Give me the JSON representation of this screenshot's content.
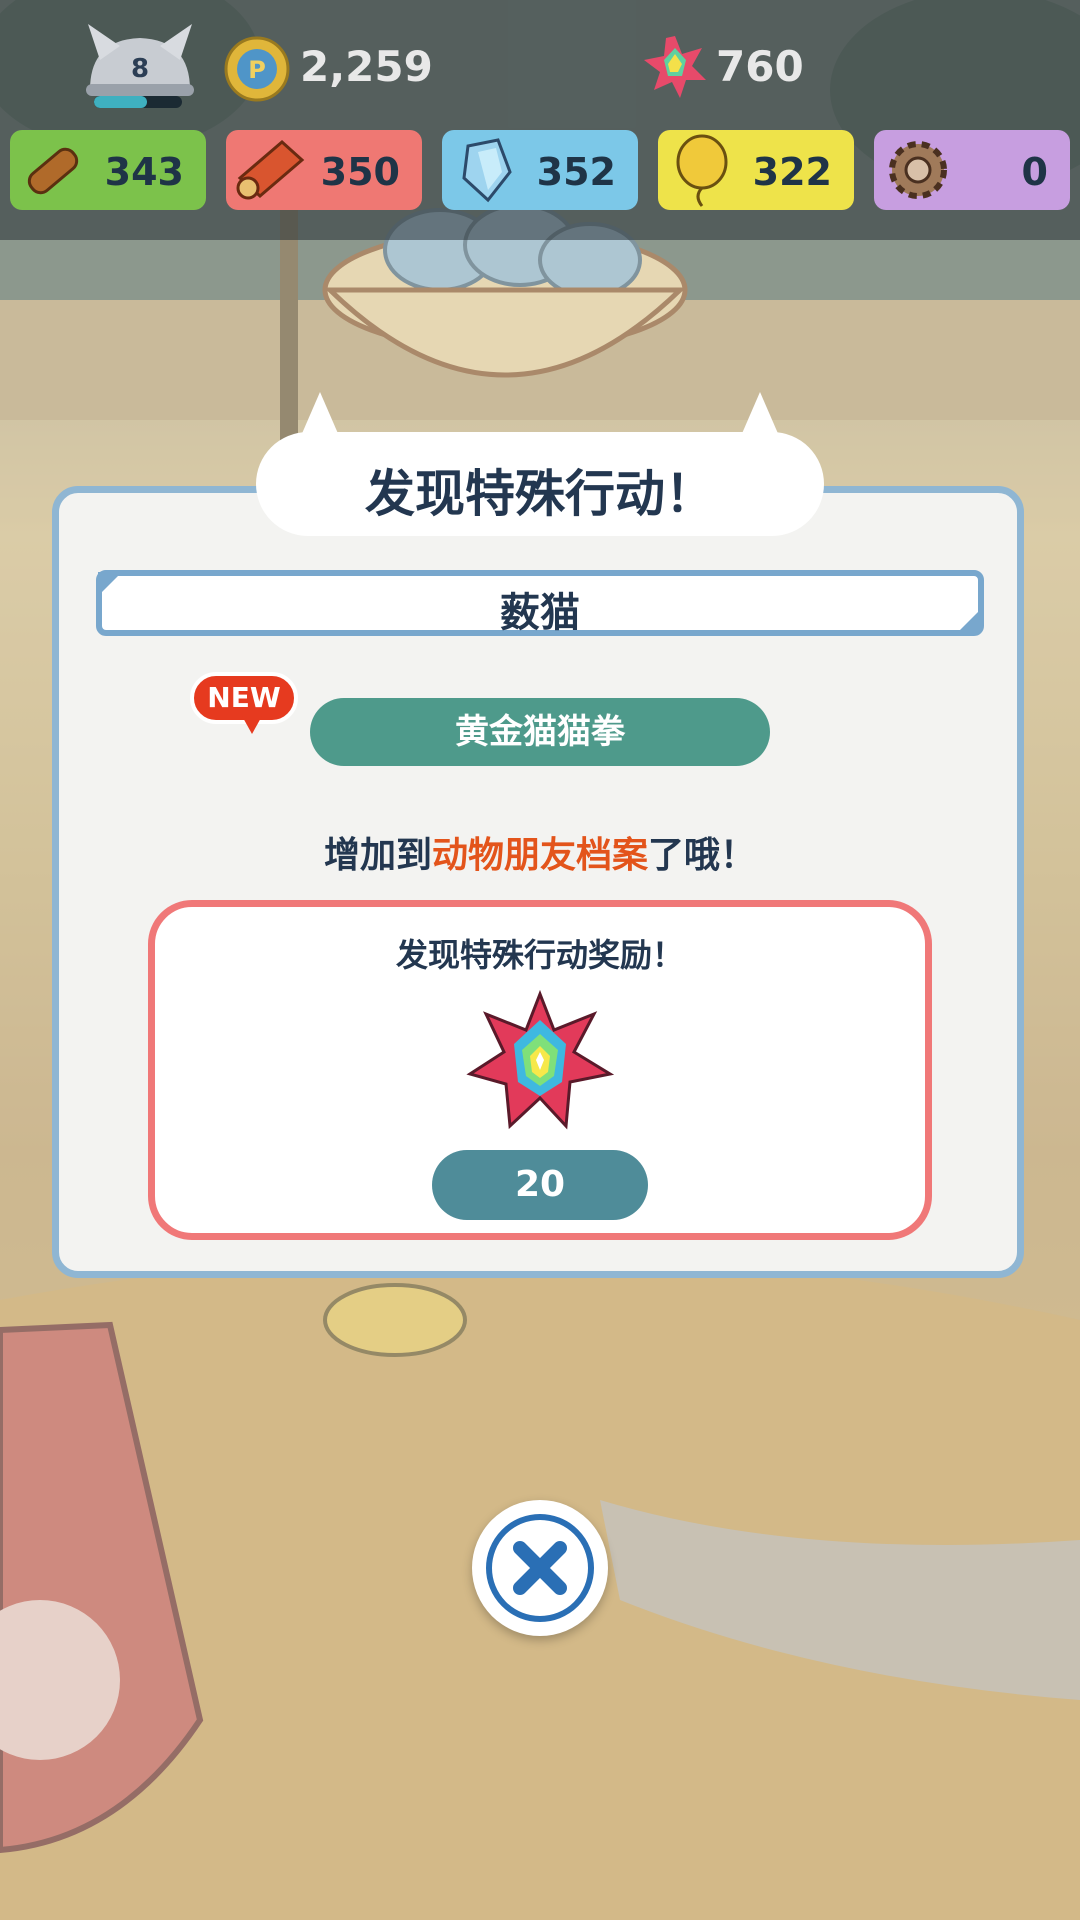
{
  "hud": {
    "level": "8",
    "level_progress": 0.6,
    "coins": "2,259",
    "gems": "760",
    "resources": [
      {
        "icon": "log-icon",
        "value": "343",
        "color": "#7cc24b"
      },
      {
        "icon": "scroll-icon",
        "value": "350",
        "color": "#ef7873"
      },
      {
        "icon": "crystal-icon",
        "value": "352",
        "color": "#7cc8e8"
      },
      {
        "icon": "balloon-icon",
        "value": "322",
        "color": "#eee34a"
      },
      {
        "icon": "gear-icon",
        "value": "0",
        "color": "#c79ee0"
      }
    ]
  },
  "dialog": {
    "title": "发现特殊行动！",
    "animal_name": "薮猫",
    "new_badge": "NEW",
    "action_name": "黄金猫猫拳",
    "added_prefix": "增加到",
    "added_highlight": "动物朋友档案",
    "added_suffix": "了哦！",
    "reward_title": "发现特殊行动奖励！",
    "reward_icon": "rainbow-gem-icon",
    "reward_count": "20"
  },
  "close_button": {
    "icon": "close-icon"
  }
}
